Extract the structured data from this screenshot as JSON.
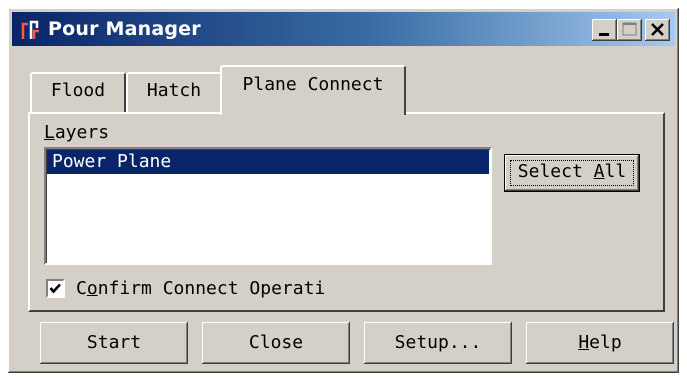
{
  "window": {
    "title": "Pour Manager",
    "icon": "pour-manager-app-icon",
    "controls": {
      "minimize": "minimize-icon",
      "maximize": "maximize-icon",
      "close": "close-icon"
    }
  },
  "tabs": [
    {
      "label": "Flood",
      "active": false
    },
    {
      "label": "Hatch",
      "active": false
    },
    {
      "label": "Plane Connect",
      "active": true
    }
  ],
  "panel": {
    "layers_label": {
      "mnemonic": "L",
      "rest": "ayers"
    },
    "layers": [
      {
        "label": "Power Plane",
        "selected": true
      }
    ],
    "select_all": {
      "prefix": "Select ",
      "mnemonic": "A",
      "rest": "ll"
    },
    "confirm": {
      "checked": true,
      "prefix": "C",
      "mnemonic": "o",
      "rest": "nfirm Connect Operati"
    }
  },
  "buttons": {
    "start": "Start",
    "close": "Close",
    "setup": "Setup...",
    "help": {
      "mnemonic": "H",
      "rest": "elp"
    }
  },
  "colors": {
    "title_start": "#0a246a",
    "title_end": "#a6caf0",
    "face": "#d4d0c8",
    "selection": "#0a246a"
  }
}
